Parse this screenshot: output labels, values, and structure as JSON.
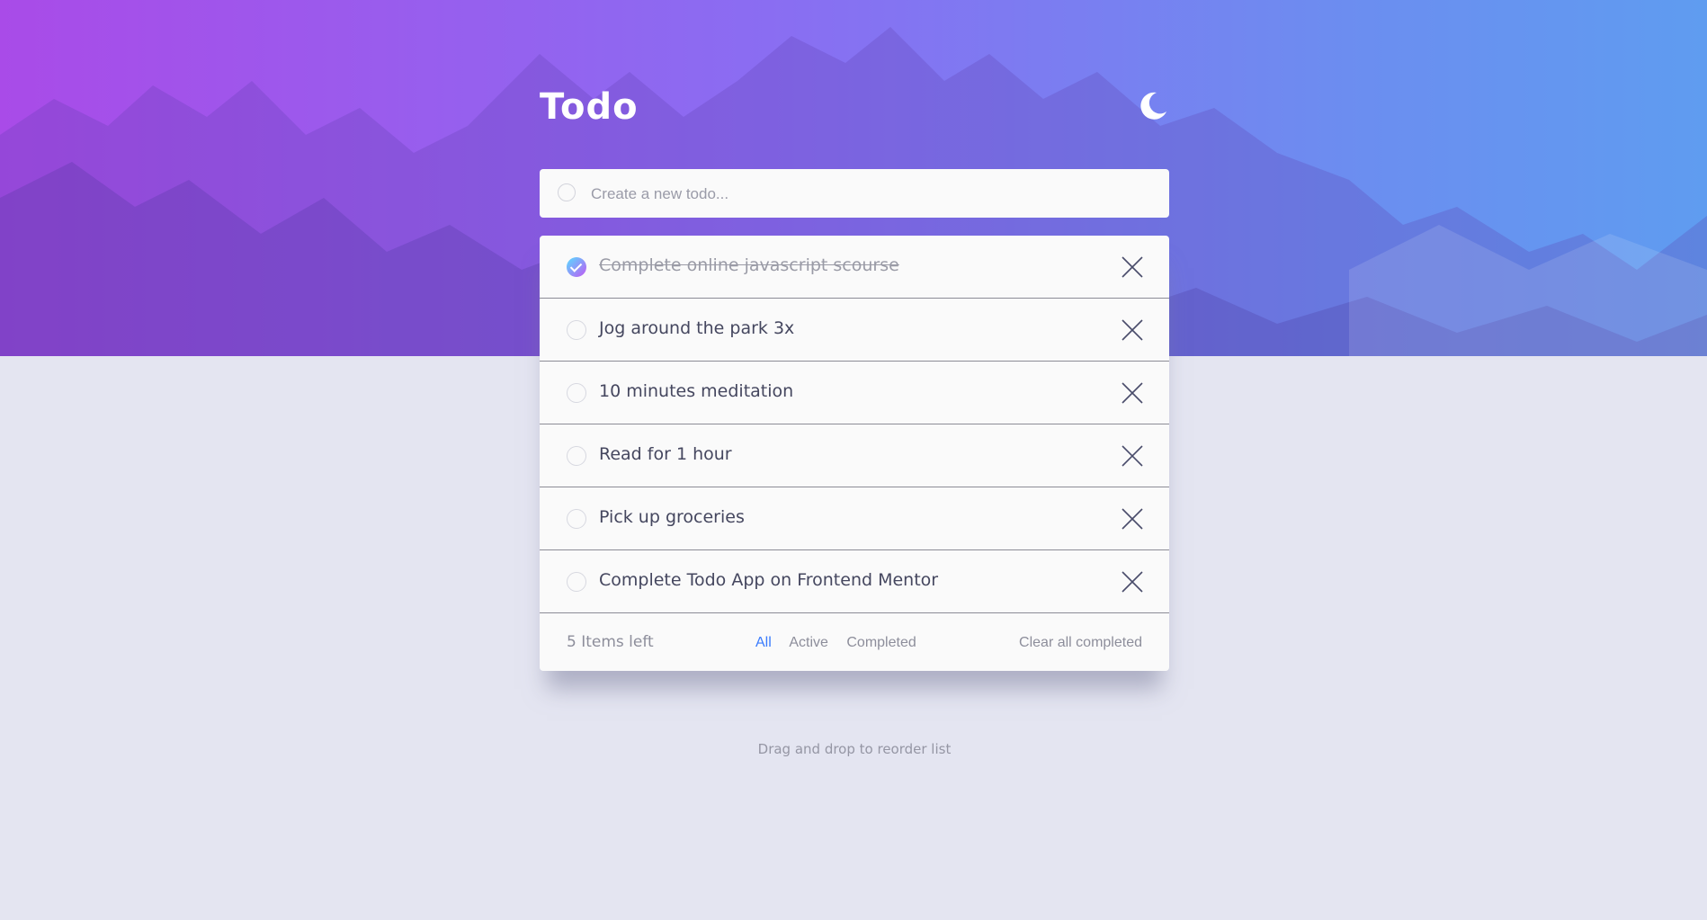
{
  "app": {
    "title": "Todo",
    "theme_icon": "moon-icon"
  },
  "new_todo": {
    "placeholder": "Create a new todo..."
  },
  "todos": [
    {
      "text": "Complete online javascript scourse",
      "completed": true
    },
    {
      "text": "Jog around the park 3x",
      "completed": false
    },
    {
      "text": "10 minutes meditation",
      "completed": false
    },
    {
      "text": "Read for 1 hour",
      "completed": false
    },
    {
      "text": "Pick up groceries",
      "completed": false
    },
    {
      "text": "Complete Todo App on Frontend Mentor",
      "completed": false
    }
  ],
  "footer": {
    "items_left": "5 Items left",
    "filters": [
      "All",
      "Active",
      "Completed"
    ],
    "active_filter": "All",
    "clear_label": "Clear all completed"
  },
  "hint": "Drag and drop to reorder list",
  "colors": {
    "gradient_start": "#a94be8",
    "gradient_end": "#5f9cf0",
    "active_filter": "#3a7bfd",
    "check_gradient_start": "#57ddff",
    "check_gradient_end": "#c058f3",
    "background": "#e4e5f1"
  }
}
